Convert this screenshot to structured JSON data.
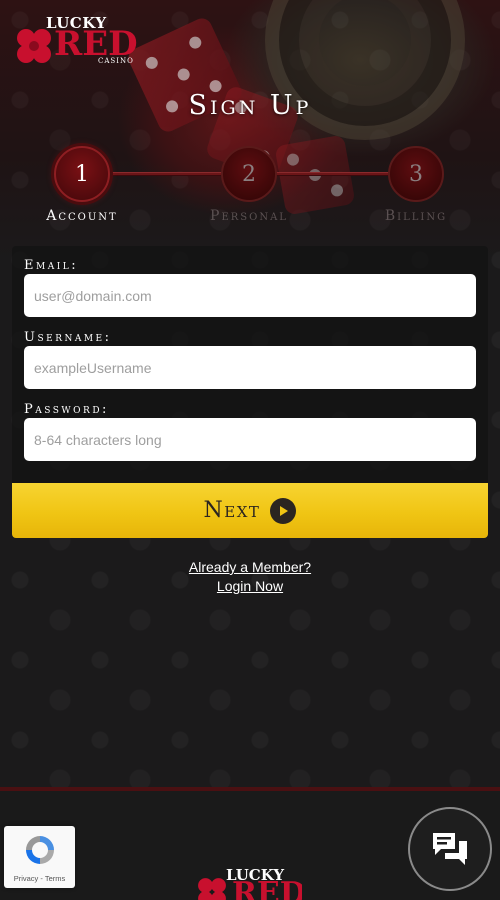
{
  "brand": {
    "logo_lucky": "LUCKY",
    "logo_red": "RED",
    "logo_casino": "CASINO"
  },
  "page": {
    "title": "Sign Up"
  },
  "steps": [
    {
      "number": "1",
      "label": "Account",
      "active": true
    },
    {
      "number": "2",
      "label": "Personal",
      "active": false
    },
    {
      "number": "3",
      "label": "Billing",
      "active": false
    }
  ],
  "form": {
    "email": {
      "label": "Email:",
      "value": "",
      "placeholder": "user@domain.com"
    },
    "username": {
      "label": "Username:",
      "value": "",
      "placeholder": "exampleUsername"
    },
    "password": {
      "label": "Password:",
      "value": "",
      "placeholder": "8-64 characters long"
    },
    "next_label": "Next"
  },
  "member": {
    "line1": "Already a Member?",
    "line2": "Login Now"
  },
  "recaptcha": {
    "text": "Privacy - Terms"
  },
  "colors": {
    "accent_yellow": "#f0c514",
    "brand_red": "#c8102e",
    "step_active": "#7a1014"
  },
  "icons": {
    "next": "play-circle-icon",
    "chat": "chat-bubbles-icon",
    "recaptcha": "recaptcha-icon",
    "logo": "clover-icon"
  }
}
